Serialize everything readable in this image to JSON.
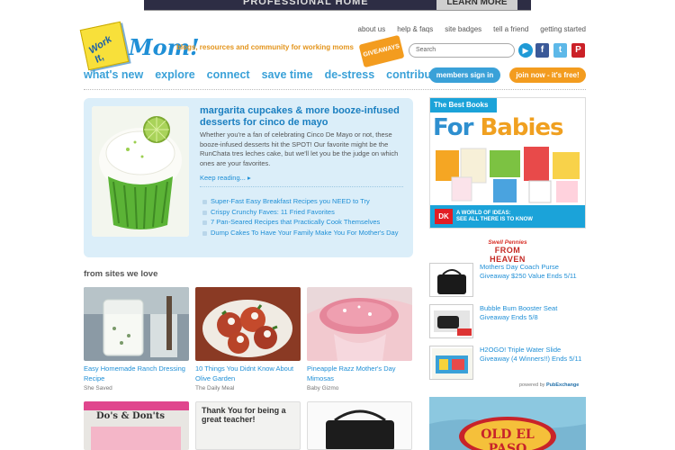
{
  "banner": {
    "text": "PROFESSIONAL HOME",
    "button": "LEARN MORE"
  },
  "logo": {
    "note": "Work It,",
    "mom": "Mom!"
  },
  "tagline": "blogs, resources and community for working moms",
  "giveaways_badge": "GIVEAWAYS",
  "top_links": [
    "about us",
    "help & faqs",
    "site badges",
    "tell a friend",
    "getting started"
  ],
  "search": {
    "placeholder": "Search",
    "go": "▶"
  },
  "social": {
    "facebook": "f",
    "twitter": "t",
    "pinterest": "P"
  },
  "nav": [
    "what's new",
    "explore",
    "connect",
    "save time",
    "de-stress",
    "contribute"
  ],
  "members_sign_in": "members sign in",
  "join_now": "join now - it's free!",
  "feature": {
    "title": "margarita cupcakes & more booze-infused desserts for cinco de mayo",
    "body": "Whether you're a fan of celebrating Cinco De Mayo or not, these booze-infused desserts hit the SPOT! Our favorite might be the RunChata tres leches cake, but we'll let you be the judge on which ones are your favorites.",
    "keep_reading": "Keep reading... ▸",
    "links": [
      "Super-Fast Easy Breakfast Recipes you NEED to Try",
      "Crispy Crunchy Faves: 11 Fried Favorites",
      "7 Pan-Seared Recipes that Practically Cook Themselves",
      "Dump Cakes To Have Your Family Make You For Mother's Day"
    ]
  },
  "from_sites": {
    "heading": "from sites we love",
    "tiles": [
      {
        "caption": "Easy Homemade Ranch Dressing Recipe",
        "source": "She Saved"
      },
      {
        "caption": "10 Things You Didnt Know About Olive Garden",
        "source": "The Daily Meal"
      },
      {
        "caption": "Pineapple Razz Mother's Day Mimosas",
        "source": "Baby Gizmo"
      }
    ],
    "lower_tiles": [
      {
        "label": "Do's & Don'ts"
      },
      {
        "label": "Thank You for being a great teacher!"
      },
      {
        "label": ""
      }
    ]
  },
  "sidebar": {
    "book_ad": {
      "top": "The Best Books",
      "for_babies": [
        "For",
        " ",
        "Babies"
      ],
      "dk": "DK",
      "bottom_line1": "A WORLD OF IDEAS:",
      "bottom_line2": "SEE ALL THERE IS TO KNOW"
    },
    "pa_heading_small": "Swell Pennies",
    "pa_heading_big": "FROM HEAVEN",
    "pa_items": [
      "Mothers Day Coach Purse Giveaway $250 Value Ends 5/11",
      "Bubble Bum Booster Seat Giveaway Ends 5/8",
      "H2OGO! Triple Water Slide Giveaway (4 Winners!!) Ends 5/11"
    ],
    "powered_label": "powered by",
    "powered_brand": "PubExchange",
    "oep": "OLD EL PASO"
  },
  "colors": {
    "accent_blue": "#3aa1d8",
    "accent_orange": "#f39c1f",
    "feature_bg": "#dbeef9"
  }
}
